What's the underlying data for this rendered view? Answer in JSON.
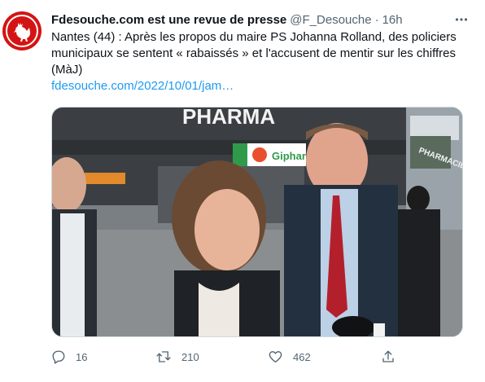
{
  "tweet": {
    "display_name": "Fdesouche.com est une revue de presse",
    "handle": "@F_Desouche",
    "separator": "·",
    "time": "16h",
    "text": "Nantes (44) : Après les propos du maire PS Johanna Rolland, des policiers municipaux se sentent « rabaissés » et l'accusent de mentir sur les chiffres (MàJ)",
    "link": "fdesouche.com/2022/10/01/jam…"
  },
  "media": {
    "sign_pharmacy": "PHARMA",
    "sign_brand": "Giphar",
    "sign_side": "PHARMACIE"
  },
  "actions": {
    "replies": "16",
    "retweets": "210",
    "likes": "462"
  },
  "icons": {
    "avatar": "rooster-icon",
    "more": "more-dots-icon",
    "reply": "reply-icon",
    "retweet": "retweet-icon",
    "like": "heart-icon",
    "share": "share-icon"
  },
  "colors": {
    "accent": "#1d9bf0",
    "avatar_bg": "#d41414",
    "secondary_text": "#536471"
  }
}
